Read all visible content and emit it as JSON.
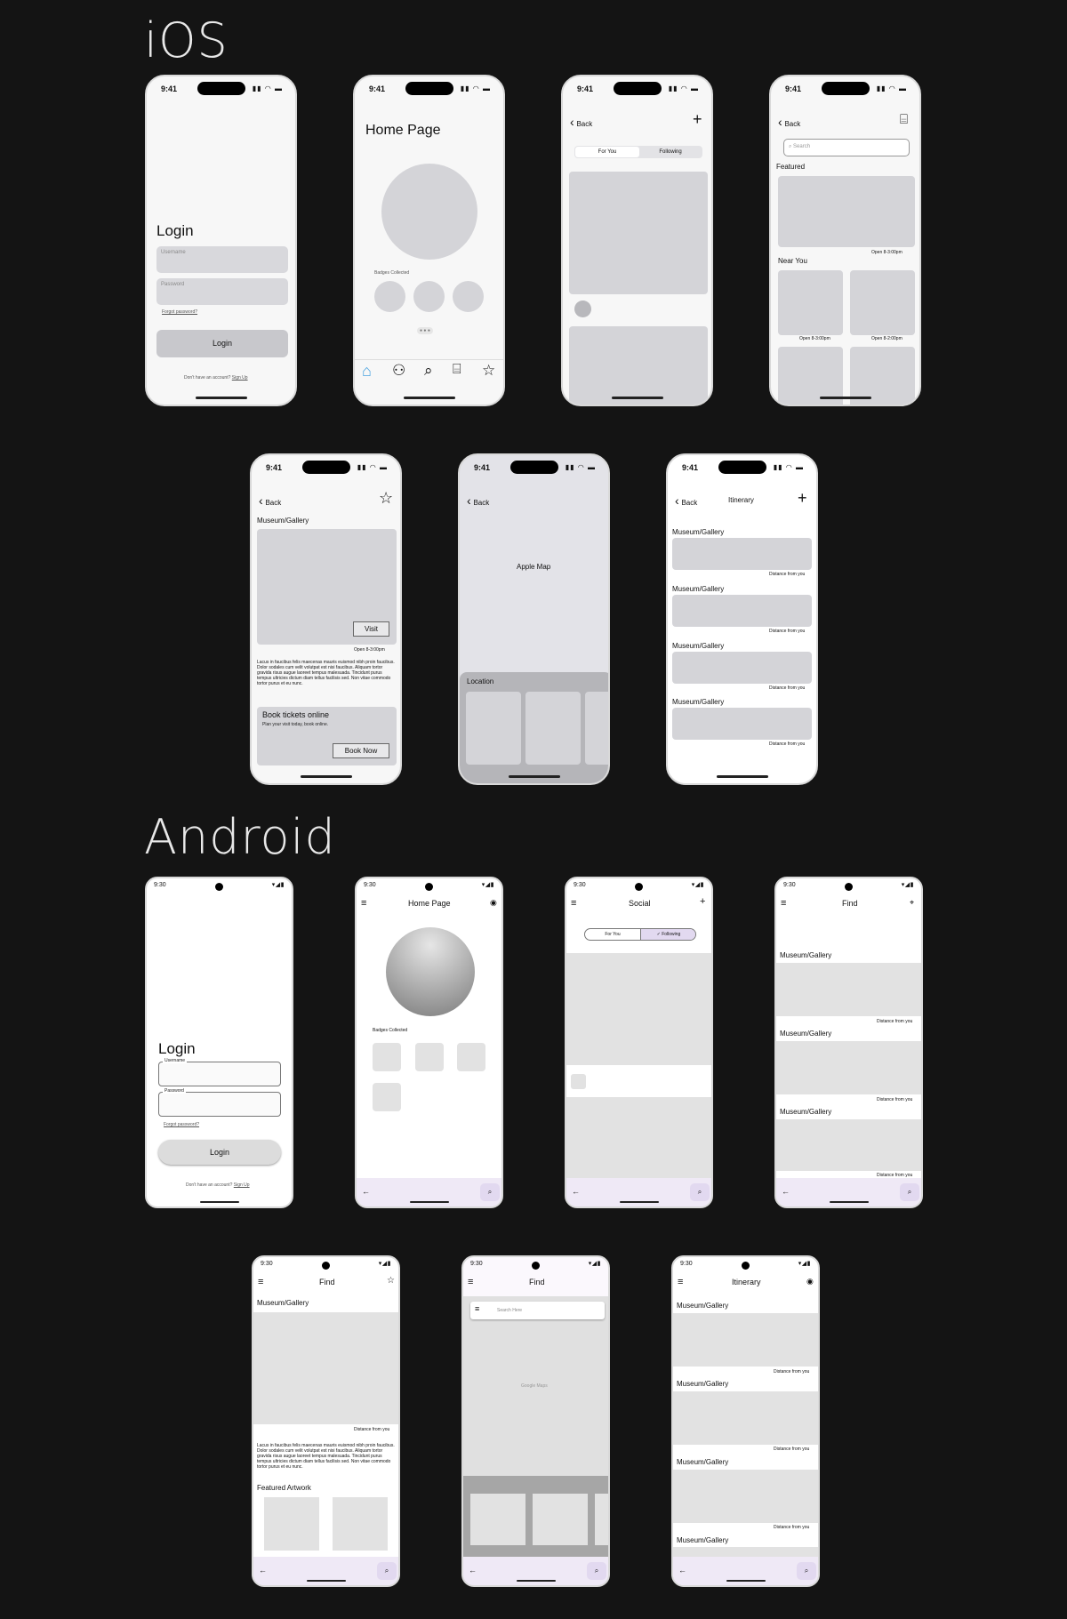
{
  "sections": {
    "ios": "iOS",
    "android": "Android"
  },
  "ios_status": {
    "time": "9:41",
    "icons": "▮▮ ◠ ▬"
  },
  "android_status": {
    "time": "9:30",
    "icons": "▾◢▮"
  },
  "ios_login": {
    "title": "Login",
    "username_placeholder": "Username",
    "password_placeholder": "Password",
    "forgot": "Forgot password?",
    "button": "Login",
    "signup_prompt": "Don't have an account?",
    "signup_link": "Sign Up"
  },
  "ios_home": {
    "title": "Home Page",
    "badges_label": "Badges Collected",
    "dots": "● ● ●"
  },
  "ios_social": {
    "back": "Back",
    "add": "+",
    "tab_for_you": "For You",
    "tab_following": "Following"
  },
  "ios_find": {
    "back": "Back",
    "search_placeholder": "Search",
    "featured": "Featured",
    "featured_hours": "Open 8-3:00pm",
    "near_you": "Near You",
    "near_hours": [
      "Open 8-3:00pm",
      "Open 8-2:00pm"
    ]
  },
  "ios_detail": {
    "back": "Back",
    "title": "Museum/Gallery",
    "visit": "Visit",
    "hours": "Open 8-3:00pm",
    "body": "Lacus in faucibus felis maecenas mauris euismod nibh proin faucibus. Dolor sodales cum velit volutpat est nisi faucibus. Aliquam tortor gravida risus augue laoreet tempus malesuada. Tincidunt purus tempus ultricies dictum diam tellus facilisis sed. Non vitae commodo tortor purus et eu nunc.",
    "book_title": "Book tickets online",
    "book_sub": "Plan your visit today, book online.",
    "book_button": "Book Now"
  },
  "ios_map": {
    "back": "Back",
    "map_label": "Apple Map",
    "location": "Location"
  },
  "ios_itinerary": {
    "back": "Back",
    "title": "Itinerary",
    "add": "+",
    "item_title": "Museum/Gallery",
    "distance": "Distance from you"
  },
  "android_login": {
    "title": "Login",
    "username": "Username",
    "password": "Password",
    "forgot": "Forgot password?",
    "button": "Login",
    "signup_prompt": "Don't have an account?",
    "signup_link": "Sign Up"
  },
  "android_home": {
    "title": "Home Page",
    "badges_label": "Badges Collected"
  },
  "android_social": {
    "title": "Social",
    "add": "+",
    "tab_for_you": "For You",
    "tab_following": "✓ Following"
  },
  "android_find": {
    "title": "Find",
    "item_title": "Museum/Gallery",
    "distance": "Distance from you"
  },
  "android_detail": {
    "title": "Find",
    "item_title": "Museum/Gallery",
    "distance": "Distance from you",
    "body": "Lacus in faucibus felis maecenas mauris euismod nibh proin faucibus. Dolor sodales cum velit volutpat est nisi faucibus. Aliquam tortor gravida risus augue laoreet tempus malesuada. Tincidunt purus tempus ultricies dictum diam tellus facilisis sed. Non vitae commodo tortor purus et eu nunc.",
    "featured_artwork": "Featured Artwork"
  },
  "android_map": {
    "title": "Find",
    "search_placeholder": "Search Here",
    "map_label": "Google Maps"
  },
  "android_itinerary": {
    "title": "Itinerary",
    "item_title": "Museum/Gallery",
    "distance": "Distance from you"
  },
  "icons": {
    "menu": "≡",
    "back_arrow": "‹",
    "android_back": "←",
    "search": "⌕",
    "star": "☆",
    "map": "⌸",
    "pin": "⌖",
    "account": "◉",
    "home": "⌂",
    "people": "⚇"
  }
}
